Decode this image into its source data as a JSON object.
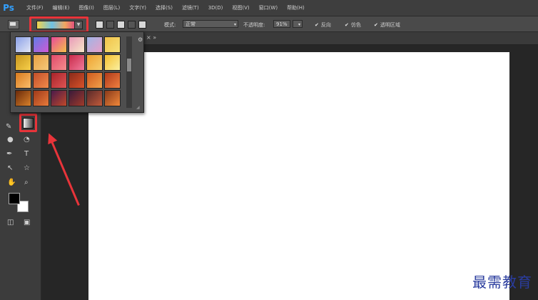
{
  "app": {
    "logo": "Ps"
  },
  "menu": [
    "文件(F)",
    "编辑(E)",
    "图像(I)",
    "图层(L)",
    "文字(Y)",
    "选择(S)",
    "滤镜(T)",
    "3D(D)",
    "视图(V)",
    "窗口(W)",
    "帮助(H)"
  ],
  "options": {
    "mode_label": "模式:",
    "mode_value": "正常",
    "opacity_label": "不透明度:",
    "opacity_value": "91%",
    "reverse_label": "反向",
    "dither_label": "仿色",
    "transparency_label": "透明区域"
  },
  "gradient_presets": [
    "#8aa0e8,#e2e6f5",
    "#5f7de6,#d05ad6",
    "#e84a9a,#f6c04a",
    "#e89ab8,#f7e7c8",
    "#9fb5e6,#e8a0c8",
    "#f1c24a,#f6e27a",
    "#c8961e,#f7d04a",
    "#e8a042,#f4c87a",
    "#e04a6a,#f58e8e",
    "#c92b4b,#f07a9a",
    "#f0a030,#f5d070",
    "#f5c030,#faf0a0",
    "#d87a1e,#fbbd6a",
    "#c44f2a,#f08a4a",
    "#a8242a,#e05454",
    "#8a2a1a,#d8522a",
    "#d05a1e,#f0a04a",
    "#b03a1a,#f08040",
    "#6a2a0a,#d8802a",
    "#a03a1a,#e87a3a",
    "#4a1a4a,#c0482a",
    "#3a1a3a,#a03a2a",
    "#5a2a2a,#c05a3a",
    "#8a3a1a,#f0883a",
    "#c06a2a,#f0b060",
    "#e08a2a,#5a3a2a",
    "#3a2a5a,#c06a8a",
    "#2a1a4a,#8a5ac0",
    "#6a3a1a,#d0a05a",
    "#a0501a,#f0c080"
  ],
  "colors": {
    "highlight": "#e8343a",
    "canvas": "#ffffff",
    "foreground": "#000000",
    "background": "#ffffff"
  },
  "watermark": "最需教育"
}
